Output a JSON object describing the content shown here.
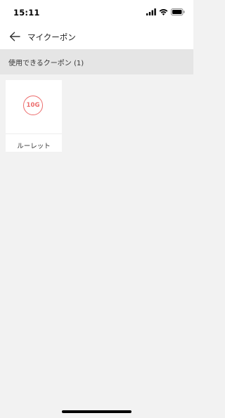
{
  "status_bar": {
    "time": "15:11",
    "icons": [
      "signal-icon",
      "wifi-icon",
      "battery-icon"
    ]
  },
  "nav": {
    "back_icon": "arrow-left-icon",
    "title": "マイクーポン"
  },
  "section": {
    "title": "使用できるクーポン (1)"
  },
  "coupons": [
    {
      "badge": "10G",
      "name": "ルーレット"
    }
  ],
  "colors": {
    "accent": "#ec6c6c",
    "background": "#f2f2f2",
    "section_header_bg": "#e5e5e5"
  }
}
